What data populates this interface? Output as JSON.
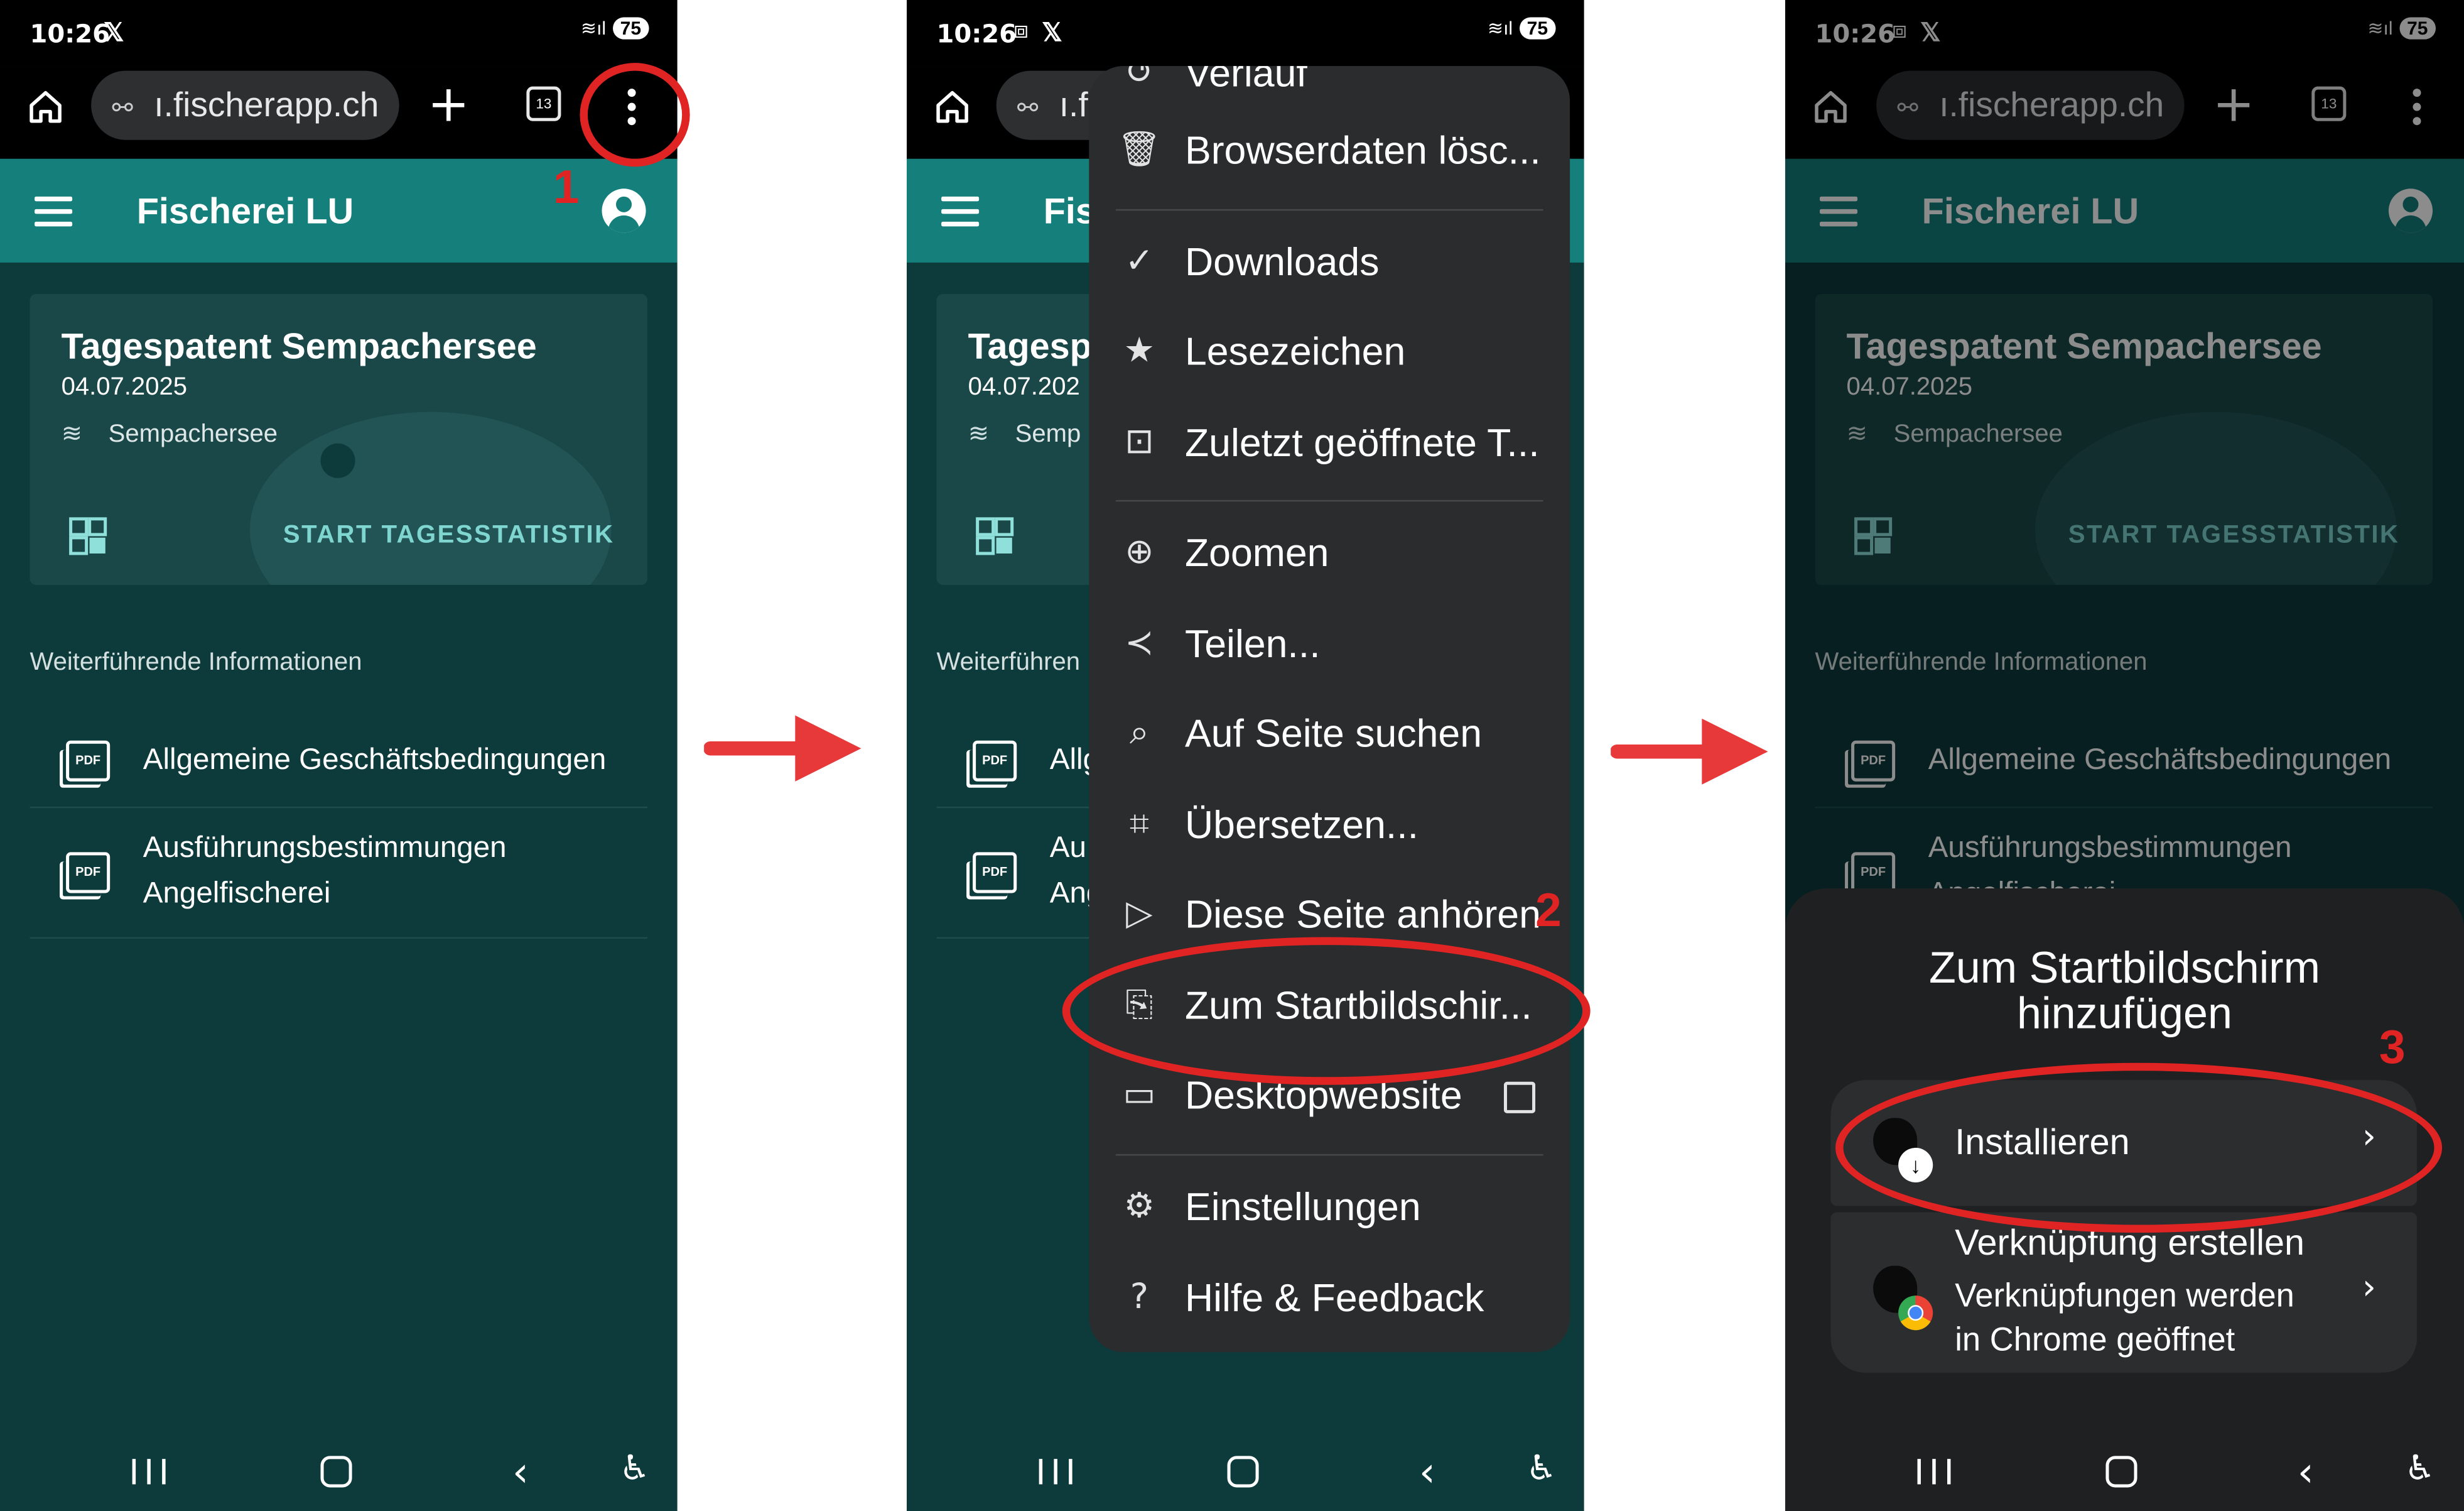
{
  "status": {
    "time": "10:26",
    "battery": "75"
  },
  "browser": {
    "url": "ı.fischerapp.ch",
    "url_short": "ı.f",
    "tab_count": "13"
  },
  "app": {
    "title": "Fischerei LU",
    "title_short": "Fis",
    "card": {
      "title": "Tagespatent Sempachersee",
      "title_short": "Tagesp",
      "date": "04.07.2025",
      "date_short": "04.07.202",
      "lake": "Sempachersee",
      "lake_short": "Semp",
      "action": "START TAGESSTATISTIK"
    },
    "section_title": "Weiterführende Informationen",
    "section_title_short": "Weiterführen",
    "links": [
      {
        "line1": "Allgemeine Geschäftsbedingungen",
        "short1": "Allg"
      },
      {
        "line1": "Ausführungsbestimmungen",
        "line2": "Angelfischerei",
        "short1": "Au",
        "short2": "Ang",
        "dim_line2": "Angelfischerei"
      }
    ]
  },
  "menu": {
    "items": [
      {
        "label": "Verlauf",
        "icon": "history-icon"
      },
      {
        "label": "Browserdaten lösc...",
        "icon": "trash-icon"
      },
      {
        "label": "Downloads",
        "icon": "download-icon"
      },
      {
        "label": "Lesezeichen",
        "icon": "star-icon"
      },
      {
        "label": "Zuletzt geöffnete T...",
        "icon": "devices-icon"
      },
      {
        "label": "Zoomen",
        "icon": "zoom-icon"
      },
      {
        "label": "Teilen...",
        "icon": "share-icon"
      },
      {
        "label": "Auf Seite suchen",
        "icon": "find-in-page-icon"
      },
      {
        "label": "Übersetzen...",
        "icon": "translate-icon"
      },
      {
        "label": "Diese Seite anhören",
        "icon": "play-icon"
      },
      {
        "label": "Zum Startbildschir...",
        "icon": "add-to-home-icon"
      },
      {
        "label": "Desktopwebsite",
        "icon": "desktop-icon"
      },
      {
        "label": "Einstellungen",
        "icon": "gear-icon"
      },
      {
        "label": "Hilfe & Feedback",
        "icon": "help-icon"
      }
    ]
  },
  "sheet": {
    "title_line1": "Zum Startbildschirm",
    "title_line2": "hinzufügen",
    "install_label": "Installieren",
    "shortcut_title": "Verknüpfung erstellen",
    "shortcut_desc1": "Verknüpfungen werden",
    "shortcut_desc2": "in Chrome geöffnet"
  },
  "annotations": {
    "step1": "1",
    "step2": "2",
    "step3": "3"
  },
  "colors": {
    "teal_bar": "#147f7b",
    "page_bg": "#0d3a3b",
    "annotation_red": "#e02424",
    "menu_bg": "#2b2c2e"
  }
}
